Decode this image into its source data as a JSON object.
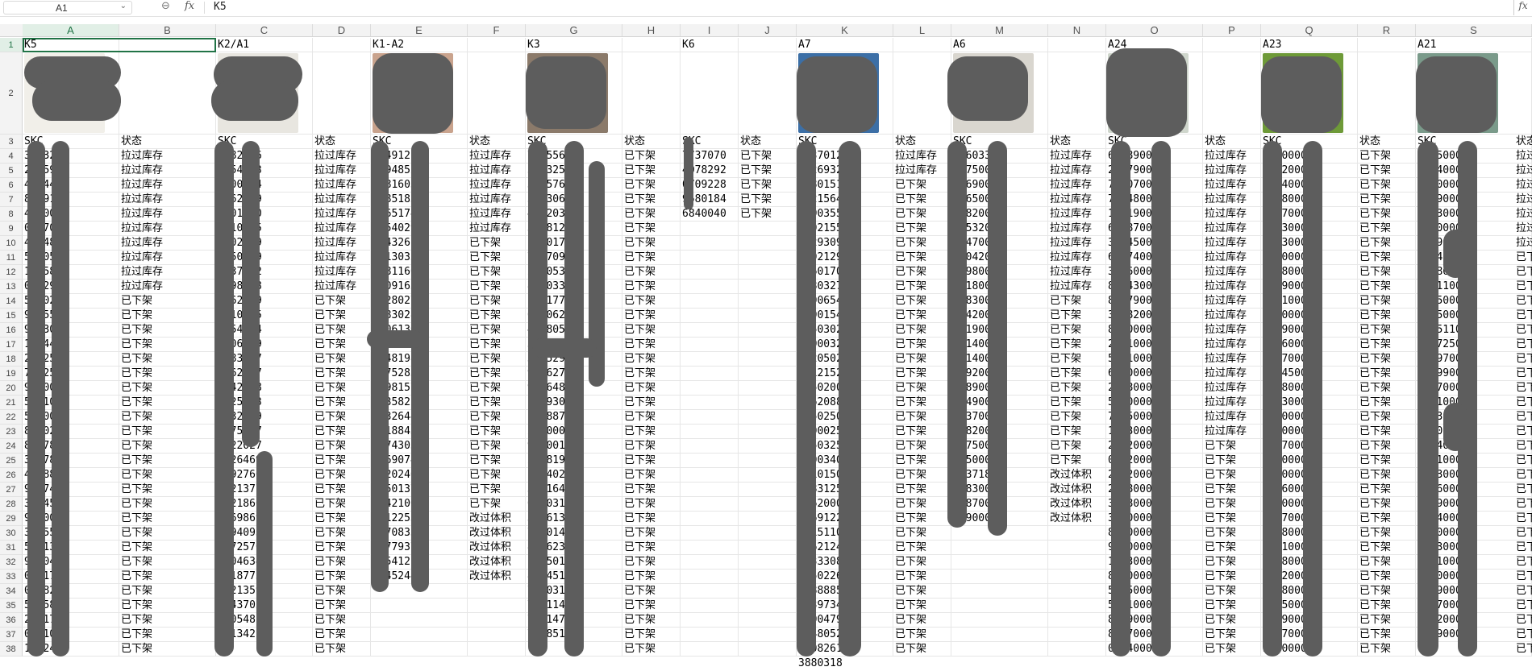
{
  "formula_bar": {
    "name_box": "A1",
    "zoom_icon": "magnify-icon",
    "fx_label": "fx",
    "value": "K5",
    "expand_label": "fx"
  },
  "columns": [
    "A",
    "B",
    "C",
    "D",
    "E",
    "F",
    "G",
    "H",
    "I",
    "J",
    "K",
    "L",
    "M",
    "N",
    "O",
    "P",
    "Q",
    "R",
    "S"
  ],
  "selected_column": "A",
  "row1": {
    "A": "K5",
    "C": "K2/A1",
    "E": "K1-A2",
    "G": "K3",
    "I": "K6",
    "K": "A7",
    "M": "A6",
    "O": "A24",
    "Q": "A23",
    "S": "A21"
  },
  "header_skc": "SKC",
  "header_status": "状态",
  "status_values": {
    "pull": "拉过库存",
    "off": "已下架",
    "vol": "改过体积",
    "pull_short": "拉过库"
  },
  "visible_numbers": {
    "A": [
      "3793271",
      "2705939",
      "4794486",
      "8599181",
      "4700009",
      "0417066",
      "4304823",
      "5250544",
      "1385839",
      "0422990",
      "5980260",
      "9665575",
      "9223001",
      "1324488",
      "2062590",
      "7782590",
      "9400039",
      "5731000",
      "5710000",
      "8340288",
      "8067818",
      "3887898",
      "4278860",
      "9207488",
      "3034565",
      "9800090",
      "3345542",
      "5011341",
      "9210475",
      "0081748",
      "0158239",
      "5885883",
      "2641747",
      "0101018",
      "1022472"
    ],
    "C": [
      "3282726",
      "1954263",
      "0200254",
      "4462949",
      "6301420",
      "4310035",
      "8502539",
      "6950169",
      "2937442",
      "1598178",
      "0162679",
      "0010625",
      "9954714",
      "2906159",
      "0983287",
      "0262487",
      "6342028",
      "1525393",
      "2532319",
      "5175717",
      "8022027",
      "5026469",
      "7592766",
      "8221377",
      "4221866",
      "3269869",
      "1094093",
      "8372570",
      "6004634",
      "3918773",
      "3121359",
      "0643705",
      "3705482",
      "4713422"
    ],
    "E": [
      "4349121",
      "2794852",
      "2781603",
      "6785183",
      "8965174",
      "2554029",
      "7843261",
      "8213035",
      "3981166",
      "1909163",
      "7628027",
      "2883028",
      "4406130",
      "2718389",
      "6848198",
      "6075283",
      "3398157",
      "6435822",
      "4432644",
      "7018845",
      "6574305",
      "7469074",
      "8020246",
      "4550137",
      "5442100",
      "1912253",
      "8570833",
      "0277937",
      "5654121",
      "0945244"
    ],
    "G": [
      "74955636",
      "5993250",
      "3575769",
      "5663063",
      "4672039",
      "3668126",
      "1120179",
      "7607094",
      "2000531",
      "8630332",
      "1411770",
      "6630620",
      "4728059",
      "3311770",
      "3615299",
      "9646274",
      "9986485",
      "1599300",
      "1588870",
      "2600000",
      "9160016",
      "2808190",
      "1004020",
      "3881647",
      "6430314",
      "3006138",
      "7000142",
      "8006235",
      "1505016",
      "8504517",
      "7040318",
      "7611140",
      "7761470",
      "7648519"
    ],
    "I": [
      "7737070",
      "4078292",
      "0709228",
      "9580184",
      "6840040"
    ],
    "K": [
      "5437012",
      "4926932",
      "5280151",
      "1321564",
      "1200355",
      "1202155",
      "1129309",
      "3302129",
      "1460170",
      "2080327",
      "1200654",
      "3200154",
      "6850302",
      "9800032",
      "1020502",
      "7012152",
      "7550200",
      "3062088",
      "6050250",
      "7600025",
      "5550325",
      "9600340",
      "1010150",
      "4083125",
      "5462000",
      "7269122",
      "4015110",
      "3562124",
      "4433308",
      "2250226",
      "4188885",
      "2539734",
      "4100479",
      "2548052",
      "4908261",
      "3880318"
    ],
    "M": [
      "3360334",
      "6975000",
      "8169000",
      "3065000",
      "8582000",
      "6653200",
      "4747000",
      "0904200",
      "0598000",
      "6918000",
      "8083000",
      "3242000",
      "7619000",
      "7714000",
      "6814000",
      "0892000",
      "2189000",
      "6149000",
      "1437000",
      "8182000",
      "6975000",
      "7250000",
      "2037180",
      "5583000",
      "4087000",
      "1390000"
    ],
    "O": [
      "6788900",
      "2837900",
      "7990700",
      "7304800",
      "1901900",
      "6608700",
      "3874500",
      "6697400",
      "3736000",
      "8414300",
      "8787900",
      "3078200",
      "8630000",
      "2221000",
      "5001000",
      "6960000",
      "2448000",
      "5560000",
      "7805000",
      "1453000",
      "2822000",
      "0282000",
      "2572000",
      "2738000",
      "3938000",
      "3150000",
      "8530000",
      "9420000",
      "1313000",
      "8000000",
      "5155000",
      "5841000",
      "8449000",
      "8197000",
      "0234000"
    ],
    "Q": [
      "2610000",
      "6652000",
      "5694000",
      "5528000",
      "2777000",
      "2663000",
      "5303000",
      "4180000",
      "3968000",
      "9889000",
      "6411000",
      "4970000",
      "3509000",
      "4616000",
      "6187000",
      "5784500",
      "5638000",
      "2823000",
      "5940000",
      "9160000",
      "8347000",
      "5590000",
      "5480000",
      "7026000",
      "8920000",
      "8327000",
      "6628000",
      "9061000",
      "2958000",
      "5132000",
      "3398000",
      "8295000",
      "4359000",
      "4337000",
      "5370000"
    ],
    "S": [
      "4185000",
      "5234000",
      "5260000",
      "6429000",
      "5173000",
      "4400000",
      "0339000",
      "0074600",
      "1008650",
      "1901100",
      "6305000",
      "5595000",
      "0215110",
      "7717250",
      "2389700",
      "9389900",
      "0527000",
      "6441000",
      "3113000",
      "7310000",
      "7714000",
      "5541000",
      "6303000",
      "3096000",
      "5649000",
      "1124000",
      "3440000",
      "0153000",
      "5591000",
      "2470000",
      "9339000",
      "7457000",
      "5502000",
      "1629000"
    ]
  },
  "status_columns": {
    "B": {
      "rows": [
        4,
        5,
        6,
        7,
        8,
        9,
        10,
        11,
        12,
        13
      ],
      "val": "pull",
      "rest_from": 14,
      "rest_val": "off"
    },
    "D": {
      "rows": [
        4,
        5,
        6,
        7,
        8,
        9,
        10,
        11,
        12,
        13
      ],
      "val": "pull",
      "rest_from": 14,
      "rest_val": "off"
    },
    "F": {
      "rows": [
        4,
        5,
        6,
        7,
        8,
        9
      ],
      "val": "pull",
      "rest_from": 10,
      "rest_val": "off",
      "rest_to": 28,
      "extra": {
        "29": "vol",
        "30": "vol",
        "31": "vol",
        "32": "vol",
        "33": "vol"
      }
    },
    "H": {
      "rows": [],
      "val": "off",
      "rest_from": 4,
      "rest_val": "off"
    },
    "J": {
      "rows": [
        4,
        5,
        6,
        7,
        8
      ],
      "val": "off"
    },
    "L": {
      "rows": [
        4,
        5
      ],
      "val": "pull",
      "rest_from": 6,
      "rest_val": "off"
    },
    "N": {
      "rows": [
        4,
        5,
        6,
        7,
        8,
        9,
        10,
        11,
        12,
        13
      ],
      "val": "pull",
      "rest_from": 14,
      "rest_val": "off",
      "rest_to": 25,
      "extra": {
        "26": "vol",
        "27": "vol",
        "28": "vol",
        "29": "vol"
      }
    },
    "P": {
      "rows": [
        4,
        5,
        6,
        7,
        8,
        9,
        10,
        11,
        12,
        13,
        14,
        15,
        16,
        17,
        18,
        19,
        20,
        21,
        22,
        23
      ],
      "val": "pull",
      "rest_from": 24,
      "rest_val": "off"
    },
    "R": {
      "rows": [],
      "val": "off",
      "rest_from": 4,
      "rest_val": "off"
    }
  },
  "visible_row_count": 38
}
